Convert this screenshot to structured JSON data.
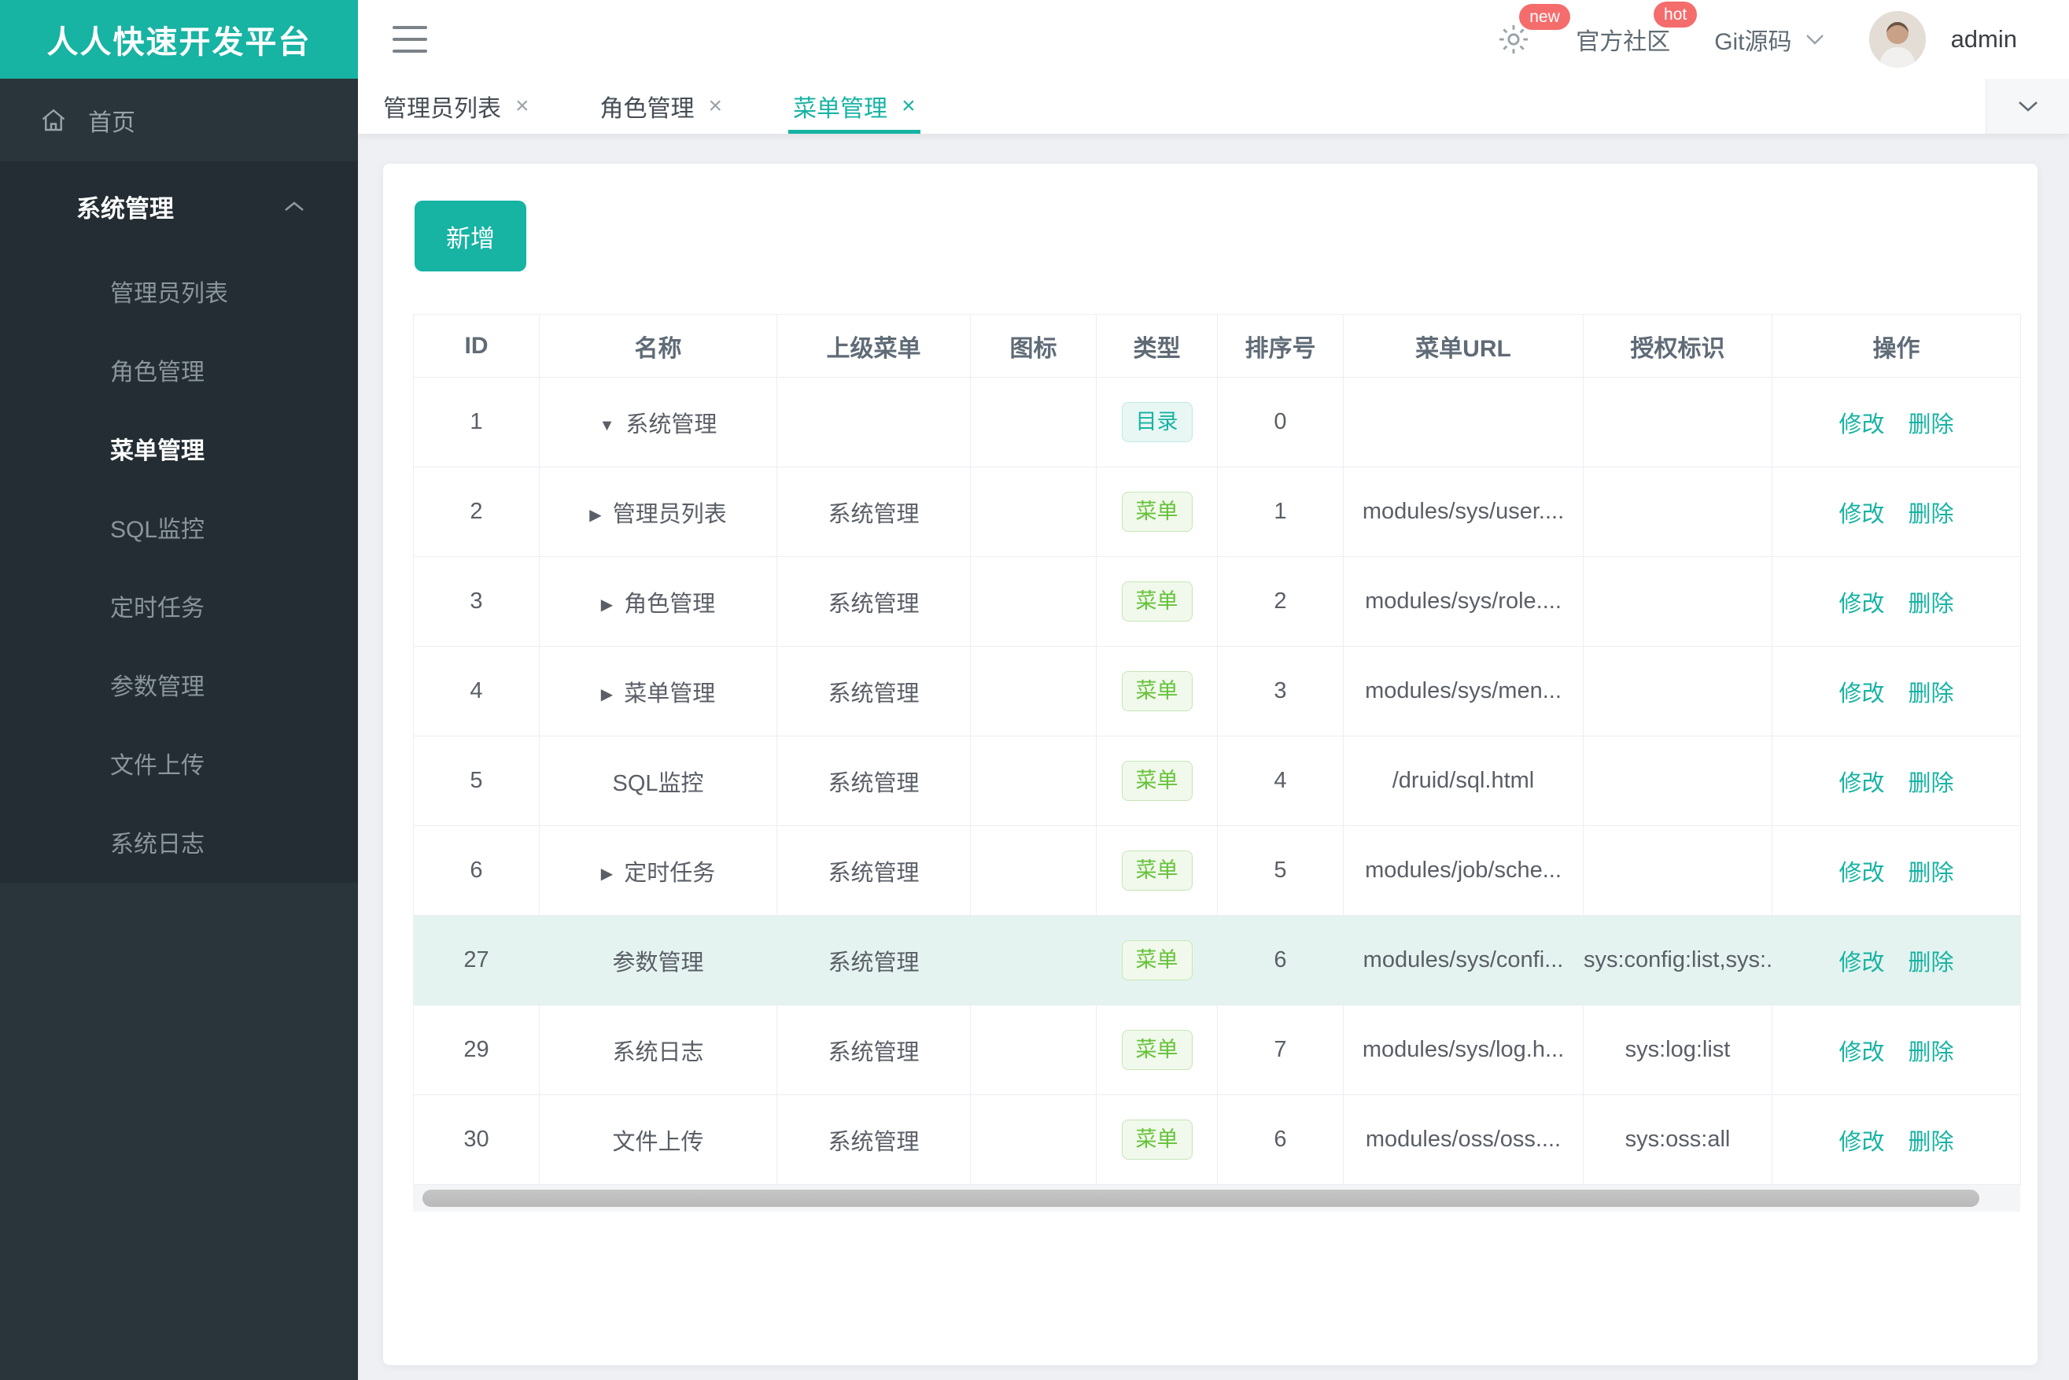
{
  "app": {
    "logo": "人人快速开发平台"
  },
  "topbar": {
    "badge_new": "new",
    "community": "官方社区",
    "badge_hot": "hot",
    "git": "Git源码",
    "username": "admin"
  },
  "sidebar": {
    "home_label": "首页",
    "group": {
      "label": "系统管理",
      "items": [
        {
          "label": "管理员列表",
          "active": false
        },
        {
          "label": "角色管理",
          "active": false
        },
        {
          "label": "菜单管理",
          "active": true
        },
        {
          "label": "SQL监控",
          "active": false
        },
        {
          "label": "定时任务",
          "active": false
        },
        {
          "label": "参数管理",
          "active": false
        },
        {
          "label": "文件上传",
          "active": false
        },
        {
          "label": "系统日志",
          "active": false
        }
      ]
    }
  },
  "tabs": [
    {
      "label": "管理员列表",
      "active": false
    },
    {
      "label": "角色管理",
      "active": false
    },
    {
      "label": "菜单管理",
      "active": true
    }
  ],
  "toolbar": {
    "add_label": "新增"
  },
  "table": {
    "columns": [
      "ID",
      "名称",
      "上级菜单",
      "图标",
      "类型",
      "排序号",
      "菜单URL",
      "授权标识",
      "操作"
    ],
    "actions": {
      "edit": "修改",
      "delete": "删除"
    },
    "tag_labels": {
      "dir": "目录",
      "menu": "菜单"
    },
    "rows": [
      {
        "id": "1",
        "caret": "down",
        "name": "系统管理",
        "parent": "",
        "icon": "",
        "type": "dir",
        "order": "0",
        "url": "",
        "perm": "",
        "highlight": false
      },
      {
        "id": "2",
        "caret": "right",
        "name": "管理员列表",
        "parent": "系统管理",
        "icon": "",
        "type": "menu",
        "order": "1",
        "url": "modules/sys/user....",
        "perm": "",
        "highlight": false
      },
      {
        "id": "3",
        "caret": "right",
        "name": "角色管理",
        "parent": "系统管理",
        "icon": "",
        "type": "menu",
        "order": "2",
        "url": "modules/sys/role....",
        "perm": "",
        "highlight": false
      },
      {
        "id": "4",
        "caret": "right",
        "name": "菜单管理",
        "parent": "系统管理",
        "icon": "",
        "type": "menu",
        "order": "3",
        "url": "modules/sys/men...",
        "perm": "",
        "highlight": false
      },
      {
        "id": "5",
        "caret": "",
        "name": "SQL监控",
        "parent": "系统管理",
        "icon": "",
        "type": "menu",
        "order": "4",
        "url": "/druid/sql.html",
        "perm": "",
        "highlight": false
      },
      {
        "id": "6",
        "caret": "right",
        "name": "定时任务",
        "parent": "系统管理",
        "icon": "",
        "type": "menu",
        "order": "5",
        "url": "modules/job/sche...",
        "perm": "",
        "highlight": false
      },
      {
        "id": "27",
        "caret": "",
        "name": "参数管理",
        "parent": "系统管理",
        "icon": "",
        "type": "menu",
        "order": "6",
        "url": "modules/sys/confi...",
        "perm": "sys:config:list,sys:...",
        "highlight": true
      },
      {
        "id": "29",
        "caret": "",
        "name": "系统日志",
        "parent": "系统管理",
        "icon": "",
        "type": "menu",
        "order": "7",
        "url": "modules/sys/log.h...",
        "perm": "sys:log:list",
        "highlight": false
      },
      {
        "id": "30",
        "caret": "",
        "name": "文件上传",
        "parent": "系统管理",
        "icon": "",
        "type": "menu",
        "order": "6",
        "url": "modules/oss/oss....",
        "perm": "sys:oss:all",
        "highlight": false
      }
    ]
  },
  "colors": {
    "accent": "#17b3a3",
    "tag_dir": "#17b3a3",
    "tag_menu": "#67c23a",
    "badge_red": "#f56c6c",
    "row_highlight": "#e4f3f0",
    "sidebar_bg": "#2a343b",
    "sidebar_submenu_bg": "#232d33"
  }
}
